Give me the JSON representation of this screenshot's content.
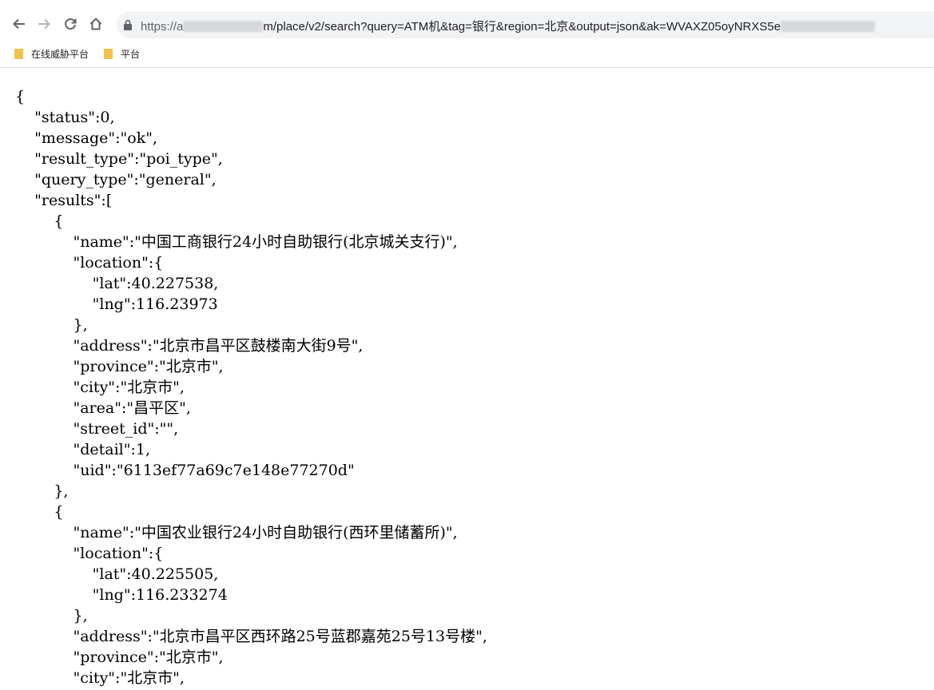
{
  "browser": {
    "url": {
      "prefix": "https://a",
      "suffix": "m/place/v2/search?query=ATM机&tag=银行&region=北京&output=json&ak=WVAXZ05oyNRXS5e"
    },
    "bookmarks": [
      {
        "label": "在线威胁平台",
        "icon": "folder-icon"
      },
      {
        "label": "平台",
        "icon": "folder-icon"
      }
    ],
    "icons": {
      "back": "arrow-left-icon",
      "forward": "arrow-right-icon",
      "reload": "reload-icon",
      "home": "home-icon",
      "secure": "lock-icon"
    }
  },
  "json_text": "{\n    \"status\":0,\n    \"message\":\"ok\",\n    \"result_type\":\"poi_type\",\n    \"query_type\":\"general\",\n    \"results\":[\n        {\n            \"name\":\"中国工商银行24小时自助银行(北京城关支行)\",\n            \"location\":{\n                \"lat\":40.227538,\n                \"lng\":116.23973\n            },\n            \"address\":\"北京市昌平区鼓楼南大街9号\",\n            \"province\":\"北京市\",\n            \"city\":\"北京市\",\n            \"area\":\"昌平区\",\n            \"street_id\":\"\",\n            \"detail\":1,\n            \"uid\":\"6113ef77a69c7e148e77270d\"\n        },\n        {\n            \"name\":\"中国农业银行24小时自助银行(西环里储蓄所)\",\n            \"location\":{\n                \"lat\":40.225505,\n                \"lng\":116.233274\n            },\n            \"address\":\"北京市昌平区西环路25号蓝郡嘉苑25号13号楼\",\n            \"province\":\"北京市\",\n            \"city\":\"北京市\","
}
